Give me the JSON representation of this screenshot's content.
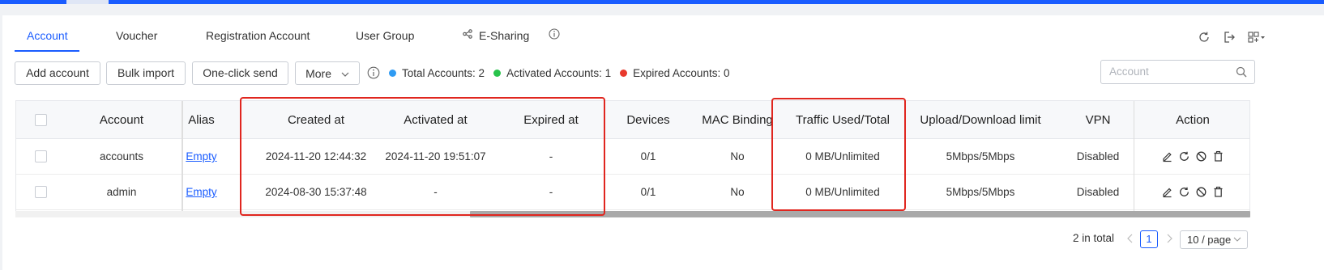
{
  "tabs": [
    {
      "label": "Account",
      "active": true
    },
    {
      "label": "Voucher",
      "active": false
    },
    {
      "label": "Registration Account",
      "active": false
    },
    {
      "label": "User Group",
      "active": false
    },
    {
      "label": "E-Sharing",
      "active": false
    }
  ],
  "toolbar": {
    "add_account": "Add account",
    "bulk_import": "Bulk import",
    "one_click_send": "One-click send",
    "more": "More"
  },
  "stats": {
    "total": "Total Accounts: 2",
    "activated": "Activated Accounts: 1",
    "expired": "Expired Accounts: 0",
    "colors": {
      "total": "#2f9bf3",
      "activated": "#28c34b",
      "expired": "#e8392c"
    }
  },
  "search": {
    "placeholder": "Account"
  },
  "table": {
    "headers": {
      "account": "Account",
      "alias": "Alias",
      "created_at": "Created at",
      "activated_at": "Activated at",
      "expired_at": "Expired at",
      "devices": "Devices",
      "mac_binding": "MAC Binding",
      "traffic": "Traffic Used/Total",
      "updown": "Upload/Download limit",
      "vpn": "VPN",
      "action": "Action"
    },
    "rows": [
      {
        "account": "accounts",
        "alias": "Empty",
        "created_at": "2024-11-20 12:44:32",
        "activated_at": "2024-11-20 19:51:07",
        "expired_at": "-",
        "devices": "0/1",
        "mac_binding": "No",
        "traffic": "0 MB/Unlimited",
        "updown": "5Mbps/5Mbps",
        "vpn": "Disabled"
      },
      {
        "account": "admin",
        "alias": "Empty",
        "created_at": "2024-08-30 15:37:48",
        "activated_at": "-",
        "expired_at": "-",
        "devices": "0/1",
        "mac_binding": "No",
        "traffic": "0 MB/Unlimited",
        "updown": "5Mbps/5Mbps",
        "vpn": "Disabled"
      }
    ]
  },
  "pagination": {
    "total": "2 in total",
    "current_page": "1",
    "page_size": "10 / page"
  },
  "colors": {
    "accent": "#1a5cff",
    "highlight": "#e0261f"
  }
}
